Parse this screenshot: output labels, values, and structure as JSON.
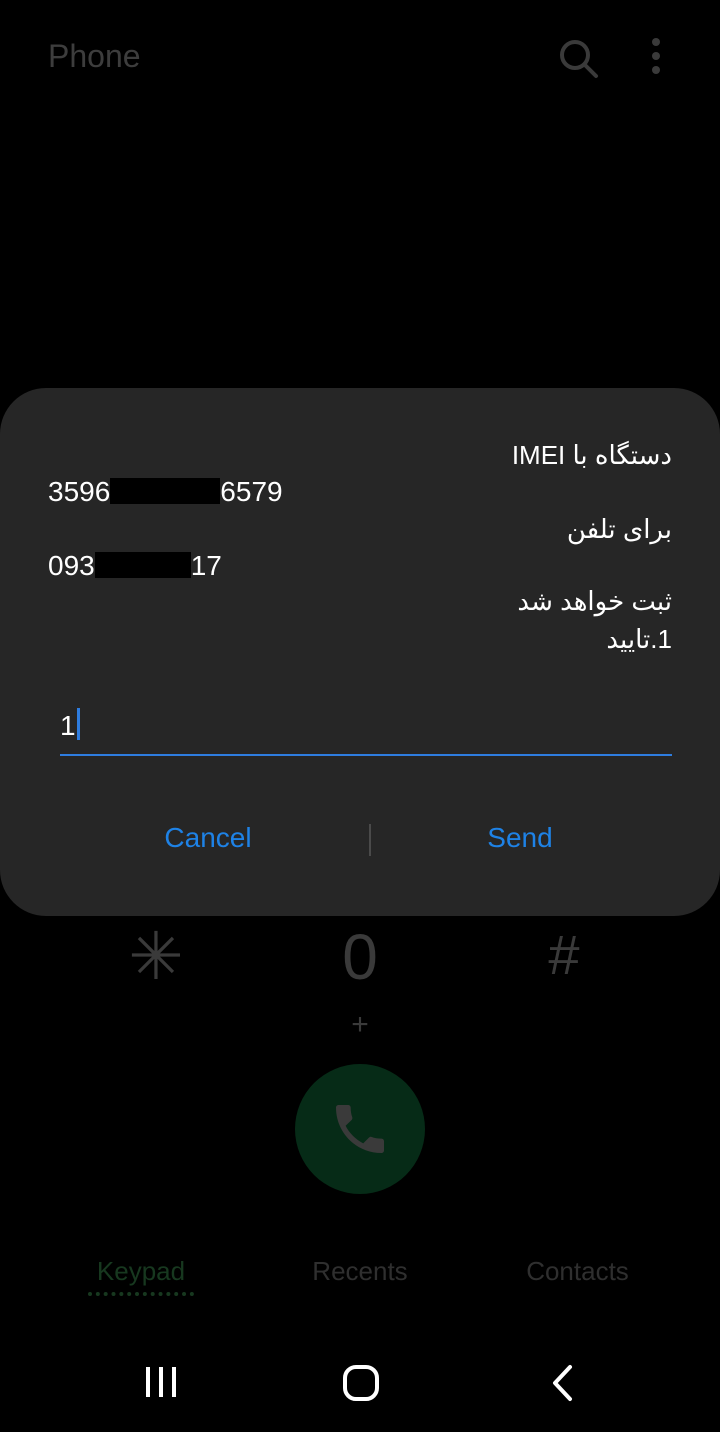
{
  "header": {
    "title": "Phone",
    "search_icon": "search-icon",
    "more_icon": "more-options-icon"
  },
  "dialog": {
    "line1": "دستگاه با IMEI",
    "imei_start": "3596",
    "imei_end": "6579",
    "line3": "برای تلفن",
    "phone_start": "093",
    "phone_end": "17",
    "line5": "ثبت خواهد شد",
    "line6": "1.تایید",
    "input_value": "1",
    "cancel_label": "Cancel",
    "send_label": "Send"
  },
  "keypad": {
    "star": "✳",
    "zero": "0",
    "hash": "#",
    "plus": "+"
  },
  "tabs": [
    {
      "label": "Keypad"
    },
    {
      "label": "Recents"
    },
    {
      "label": "Contacts"
    }
  ],
  "colors": {
    "accent": "#1e82e6",
    "call_bg": "#062b17"
  }
}
